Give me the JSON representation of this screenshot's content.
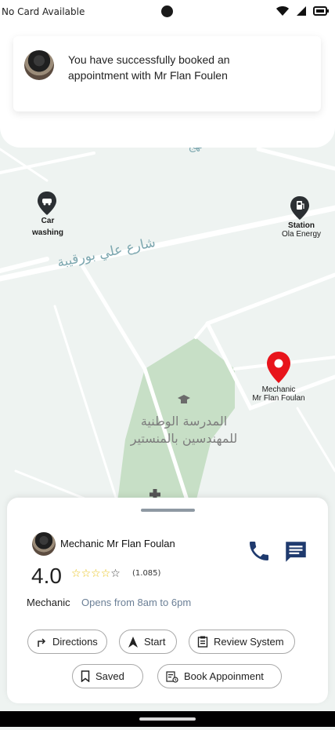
{
  "status_bar": {
    "carrier_text": "No Card Available",
    "icons": [
      "wifi-icon",
      "signal-icon",
      "battery-icon"
    ]
  },
  "notification": {
    "message": "You have successfully booked an appointment with Mr Flan Foulen"
  },
  "map": {
    "markers": [
      {
        "icon": "car-wash-icon",
        "title": "Car washing",
        "subtitle": ""
      },
      {
        "icon": "fuel-station-icon",
        "title": "Station",
        "subtitle": "Ola Energy"
      },
      {
        "icon": "location-pin-icon",
        "title": "Mechanic",
        "subtitle": "Mr Flan Foulan"
      }
    ],
    "street_label": "شارع علي بورقيبة",
    "street_label_top": "نهج",
    "poi_label_line1": "المدرسة الوطنية",
    "poi_label_line2": "للمهندسين بالمنستير",
    "colors": {
      "pin": "#e8141b",
      "marker": "#2b2f33",
      "road": "#ffffff",
      "park": "#c7dfc6"
    }
  },
  "details": {
    "shop_name": "Mechanic Mr Flan Foulan",
    "rating": "4.0",
    "stars_filled": 0,
    "stars_total": 5,
    "review_count": "(1.085)",
    "category": "Mechanic",
    "hours": "Opens from 8am to 6pm",
    "accent_color": "#1f3a6e",
    "actions": {
      "directions": "Directions",
      "start": "Start",
      "review": "Review System",
      "saved": "Saved",
      "book": "Book Appoinment"
    }
  }
}
